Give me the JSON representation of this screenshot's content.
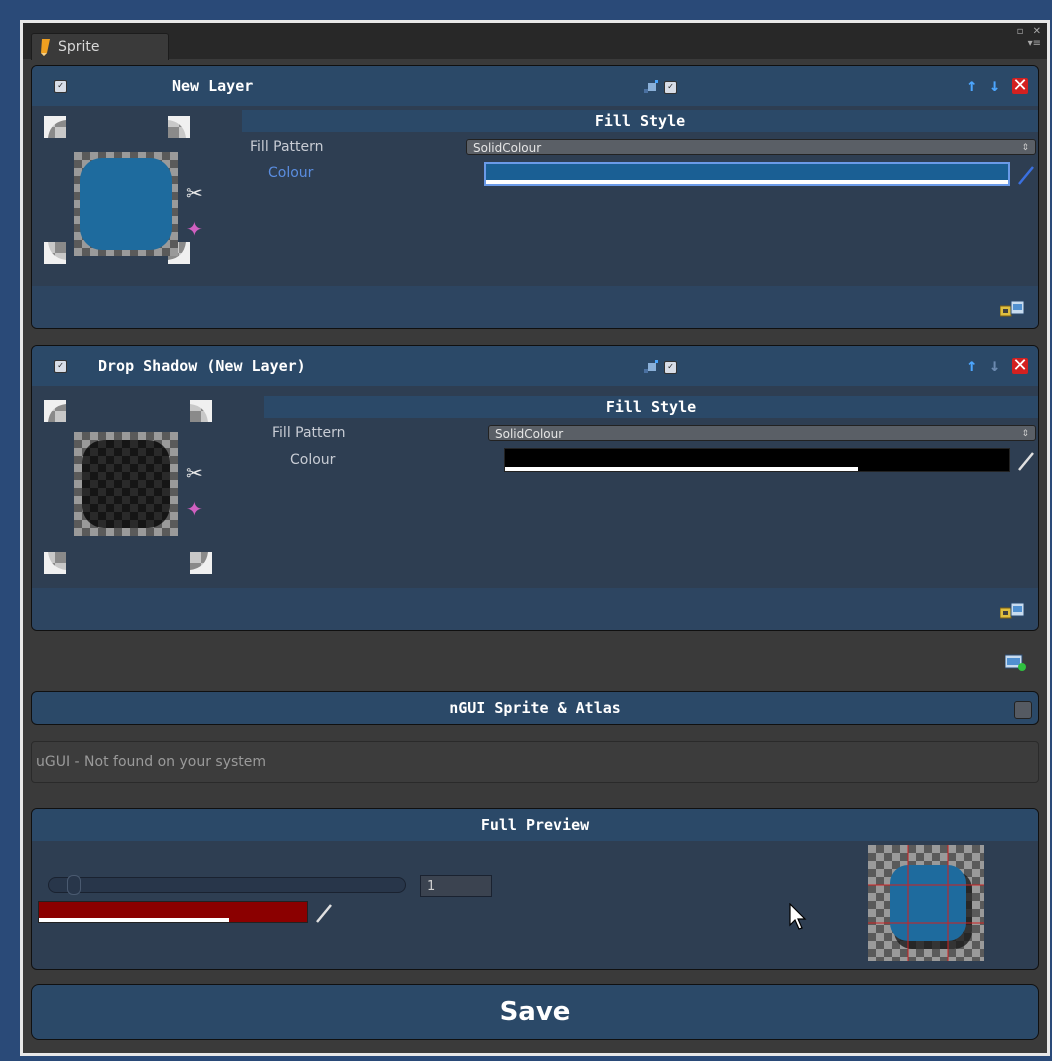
{
  "window": {
    "tab_title": "Sprite",
    "controls": [
      "▫",
      "✕",
      "▾≡"
    ]
  },
  "layers": [
    {
      "name": "New Layer",
      "enabled": true,
      "fill_style_title": "Fill Style",
      "fill_pattern_label": "Fill Pattern",
      "fill_pattern_value": "SolidColour",
      "colour_label": "Colour",
      "colour_value": "#1a5f94",
      "alpha_fraction": 1.0,
      "preview_fill": "#1e6b9e"
    },
    {
      "name": "Drop Shadow (New Layer)",
      "enabled": true,
      "fill_style_title": "Fill Style",
      "fill_pattern_label": "Fill Pattern",
      "fill_pattern_value": "SolidColour",
      "colour_label": "Colour",
      "colour_value": "#000000",
      "alpha_fraction": 0.7,
      "preview_fill": "#1a1a1a"
    }
  ],
  "ngui": {
    "title": "nGUI Sprite & Atlas",
    "enabled": false
  },
  "ugui": {
    "message": "uGUI - Not found on your system"
  },
  "full_preview": {
    "title": "Full Preview",
    "slider_value": 1,
    "number_value": "1",
    "background_colour": "#8b0000",
    "background_alpha": 0.71
  },
  "save_label": "Save",
  "colors": {
    "panel_header": "#2b4968",
    "panel_body": "#2e3e52",
    "accent_blue": "#4ca6ff",
    "delete_red": "#d32020"
  }
}
